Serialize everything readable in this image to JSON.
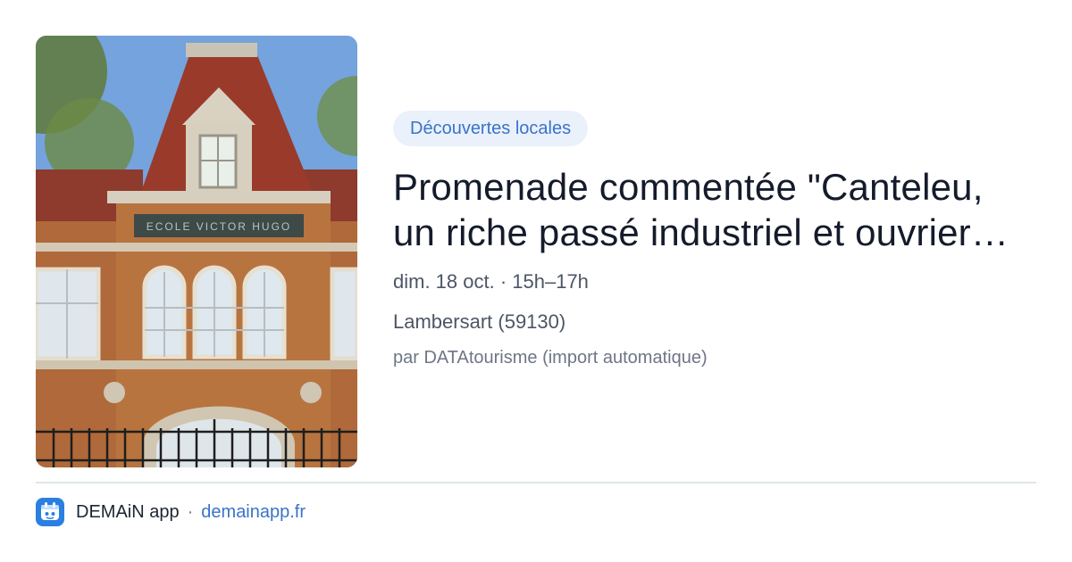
{
  "event": {
    "category": "Découvertes locales",
    "title_line1": "Promenade commentée \"Canteleu,",
    "title_line2": "un riche passé industriel et ouvrier…",
    "date_time": "dim. 18 oct. · 15h–17h",
    "location": "Lambersart (59130)",
    "source": "par DATAtourisme (import automatique)",
    "image_sign_text": "ECOLE VICTOR HUGO"
  },
  "footer": {
    "app_name": "DEMAiN app",
    "separator": "·",
    "domain": "demainapp.fr",
    "icon": "demain-app-logo-icon"
  },
  "colors": {
    "accent": "#3a73c9",
    "pill_background": "#eaf1fb",
    "title": "#141b2b",
    "app_icon": "#2a7fe0"
  }
}
